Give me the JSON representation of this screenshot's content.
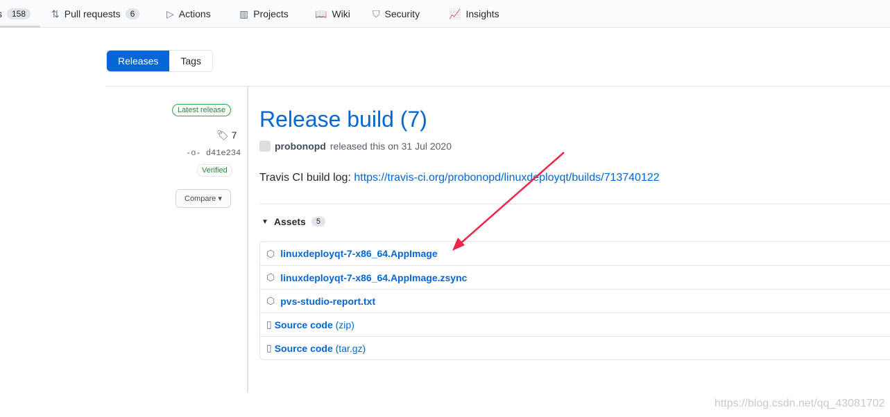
{
  "nav": {
    "issues_count": "158",
    "items": [
      {
        "label": "Pull requests",
        "count": "6",
        "icon": "pull-request-icon"
      },
      {
        "label": "Actions",
        "icon": "play-icon"
      },
      {
        "label": "Projects",
        "icon": "project-icon"
      },
      {
        "label": "Wiki",
        "icon": "book-icon"
      },
      {
        "label": "Security",
        "icon": "shield-icon"
      },
      {
        "label": "Insights",
        "icon": "graph-icon"
      }
    ]
  },
  "subnav": {
    "releases": "Releases",
    "tags": "Tags"
  },
  "sidebar": {
    "latest": "Latest release",
    "tag": "7",
    "commit": "d41e234",
    "verified": "Verified",
    "compare": "Compare"
  },
  "release": {
    "title": "Release build (7)",
    "author": "probonopd",
    "released_text": "released this on 31 Jul 2020",
    "body_label": "Travis CI build log:",
    "body_link": "https://travis-ci.org/probonopd/linuxdeployqt/builds/713740122"
  },
  "assets": {
    "label": "Assets",
    "count": "5",
    "items": [
      {
        "name": "linuxdeployqt-7-x86_64.AppImage",
        "icon": "package-icon"
      },
      {
        "name": "linuxdeployqt-7-x86_64.AppImage.zsync",
        "icon": "package-icon"
      },
      {
        "name": "pvs-studio-report.txt",
        "icon": "package-icon"
      },
      {
        "name": "Source code",
        "suffix": "(zip)",
        "icon": "file-zip-icon"
      },
      {
        "name": "Source code",
        "suffix": "(tar.gz)",
        "icon": "file-zip-icon"
      }
    ]
  },
  "annotation": {
    "arrow_color": "#f0254a"
  },
  "watermark": "https://blog.csdn.net/qq_43081702"
}
